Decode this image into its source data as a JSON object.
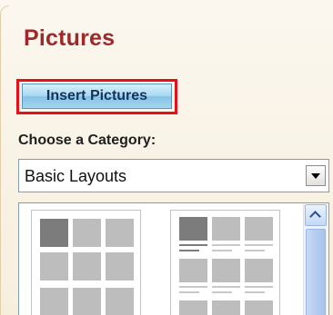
{
  "panel": {
    "title": "Pictures",
    "insert_button_label": "Insert Pictures",
    "category_label": "Choose a Category:",
    "category_selected": "Basic Layouts",
    "colors": {
      "title": "#9c2a2a",
      "highlight": "#e81018",
      "button": "#a8d8f0",
      "panel_background": "#f7efde"
    }
  },
  "gallery": {
    "layouts": [
      {
        "icon": "grid-layout-thumbnail"
      },
      {
        "icon": "captioned-grid-layout-thumbnail"
      }
    ]
  },
  "icons": {
    "dropdown": "chevron-down-icon",
    "scroll_up": "chevron-up-icon"
  }
}
